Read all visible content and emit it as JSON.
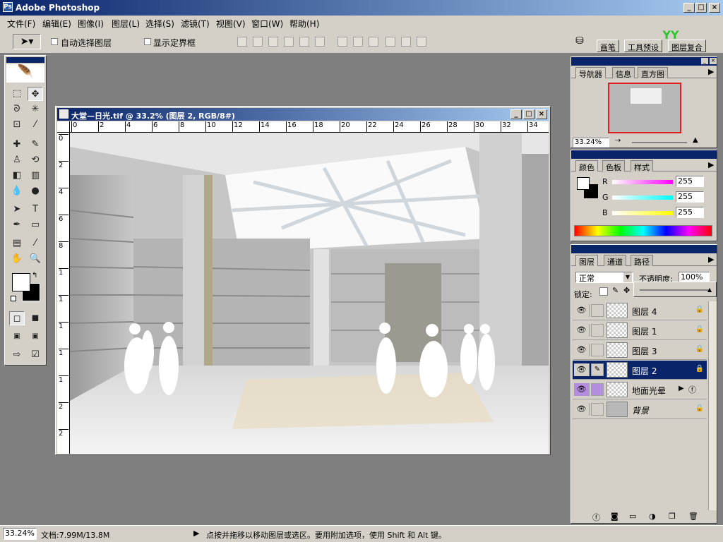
{
  "app": {
    "title": "Adobe Photoshop"
  },
  "menu": [
    "文件(F)",
    "编辑(E)",
    "图像(I)",
    "图层(L)",
    "选择(S)",
    "滤镜(T)",
    "视图(V)",
    "窗口(W)",
    "帮助(H)"
  ],
  "options": {
    "auto_select_label": "自动选择图层",
    "show_bounds_label": "显示定界框"
  },
  "well_tabs": [
    "画笔",
    "工具预设",
    "图层复合"
  ],
  "document": {
    "title": "大堂—日光.tif @ 33.2% (图层 2, RGB/8#)",
    "ruler_top": [
      "0",
      "2",
      "4",
      "6",
      "8",
      "10",
      "12",
      "14",
      "16",
      "18",
      "20",
      "22",
      "24",
      "26",
      "28",
      "30",
      "32",
      "34"
    ],
    "ruler_left": [
      "0",
      "2",
      "4",
      "6",
      "8",
      "1",
      "1",
      "1",
      "1",
      "1",
      "2",
      "2"
    ]
  },
  "navigator": {
    "tabs": [
      "导航器",
      "信息",
      "直方图"
    ],
    "zoom": "33.24%"
  },
  "color": {
    "tabs": [
      "颜色",
      "色板",
      "样式"
    ],
    "channels": [
      {
        "label": "R",
        "value": "255",
        "color": "#ff00ff"
      },
      {
        "label": "G",
        "value": "255",
        "color": "#00ffff"
      },
      {
        "label": "B",
        "value": "255",
        "color": "#ffff00"
      }
    ]
  },
  "layers": {
    "tabs": [
      "图层",
      "通道",
      "路径"
    ],
    "blend_mode": "正常",
    "opacity_label": "不透明度:",
    "opacity_value": "100%",
    "lock_label": "锁定:",
    "items": [
      {
        "name": "图层 4",
        "selected": false
      },
      {
        "name": "图层 1",
        "selected": false
      },
      {
        "name": "图层 3",
        "selected": false
      },
      {
        "name": "图层 2",
        "selected": true
      },
      {
        "name": "地面光晕",
        "selected": false
      },
      {
        "name": "背景",
        "selected": false
      }
    ]
  },
  "status": {
    "zoom": "33.24%",
    "doc_size": "文档:7.99M/13.8M",
    "hint": "点按并拖移以移动图层或选区。要用附加选项，使用 Shift 和 Alt 键。"
  }
}
